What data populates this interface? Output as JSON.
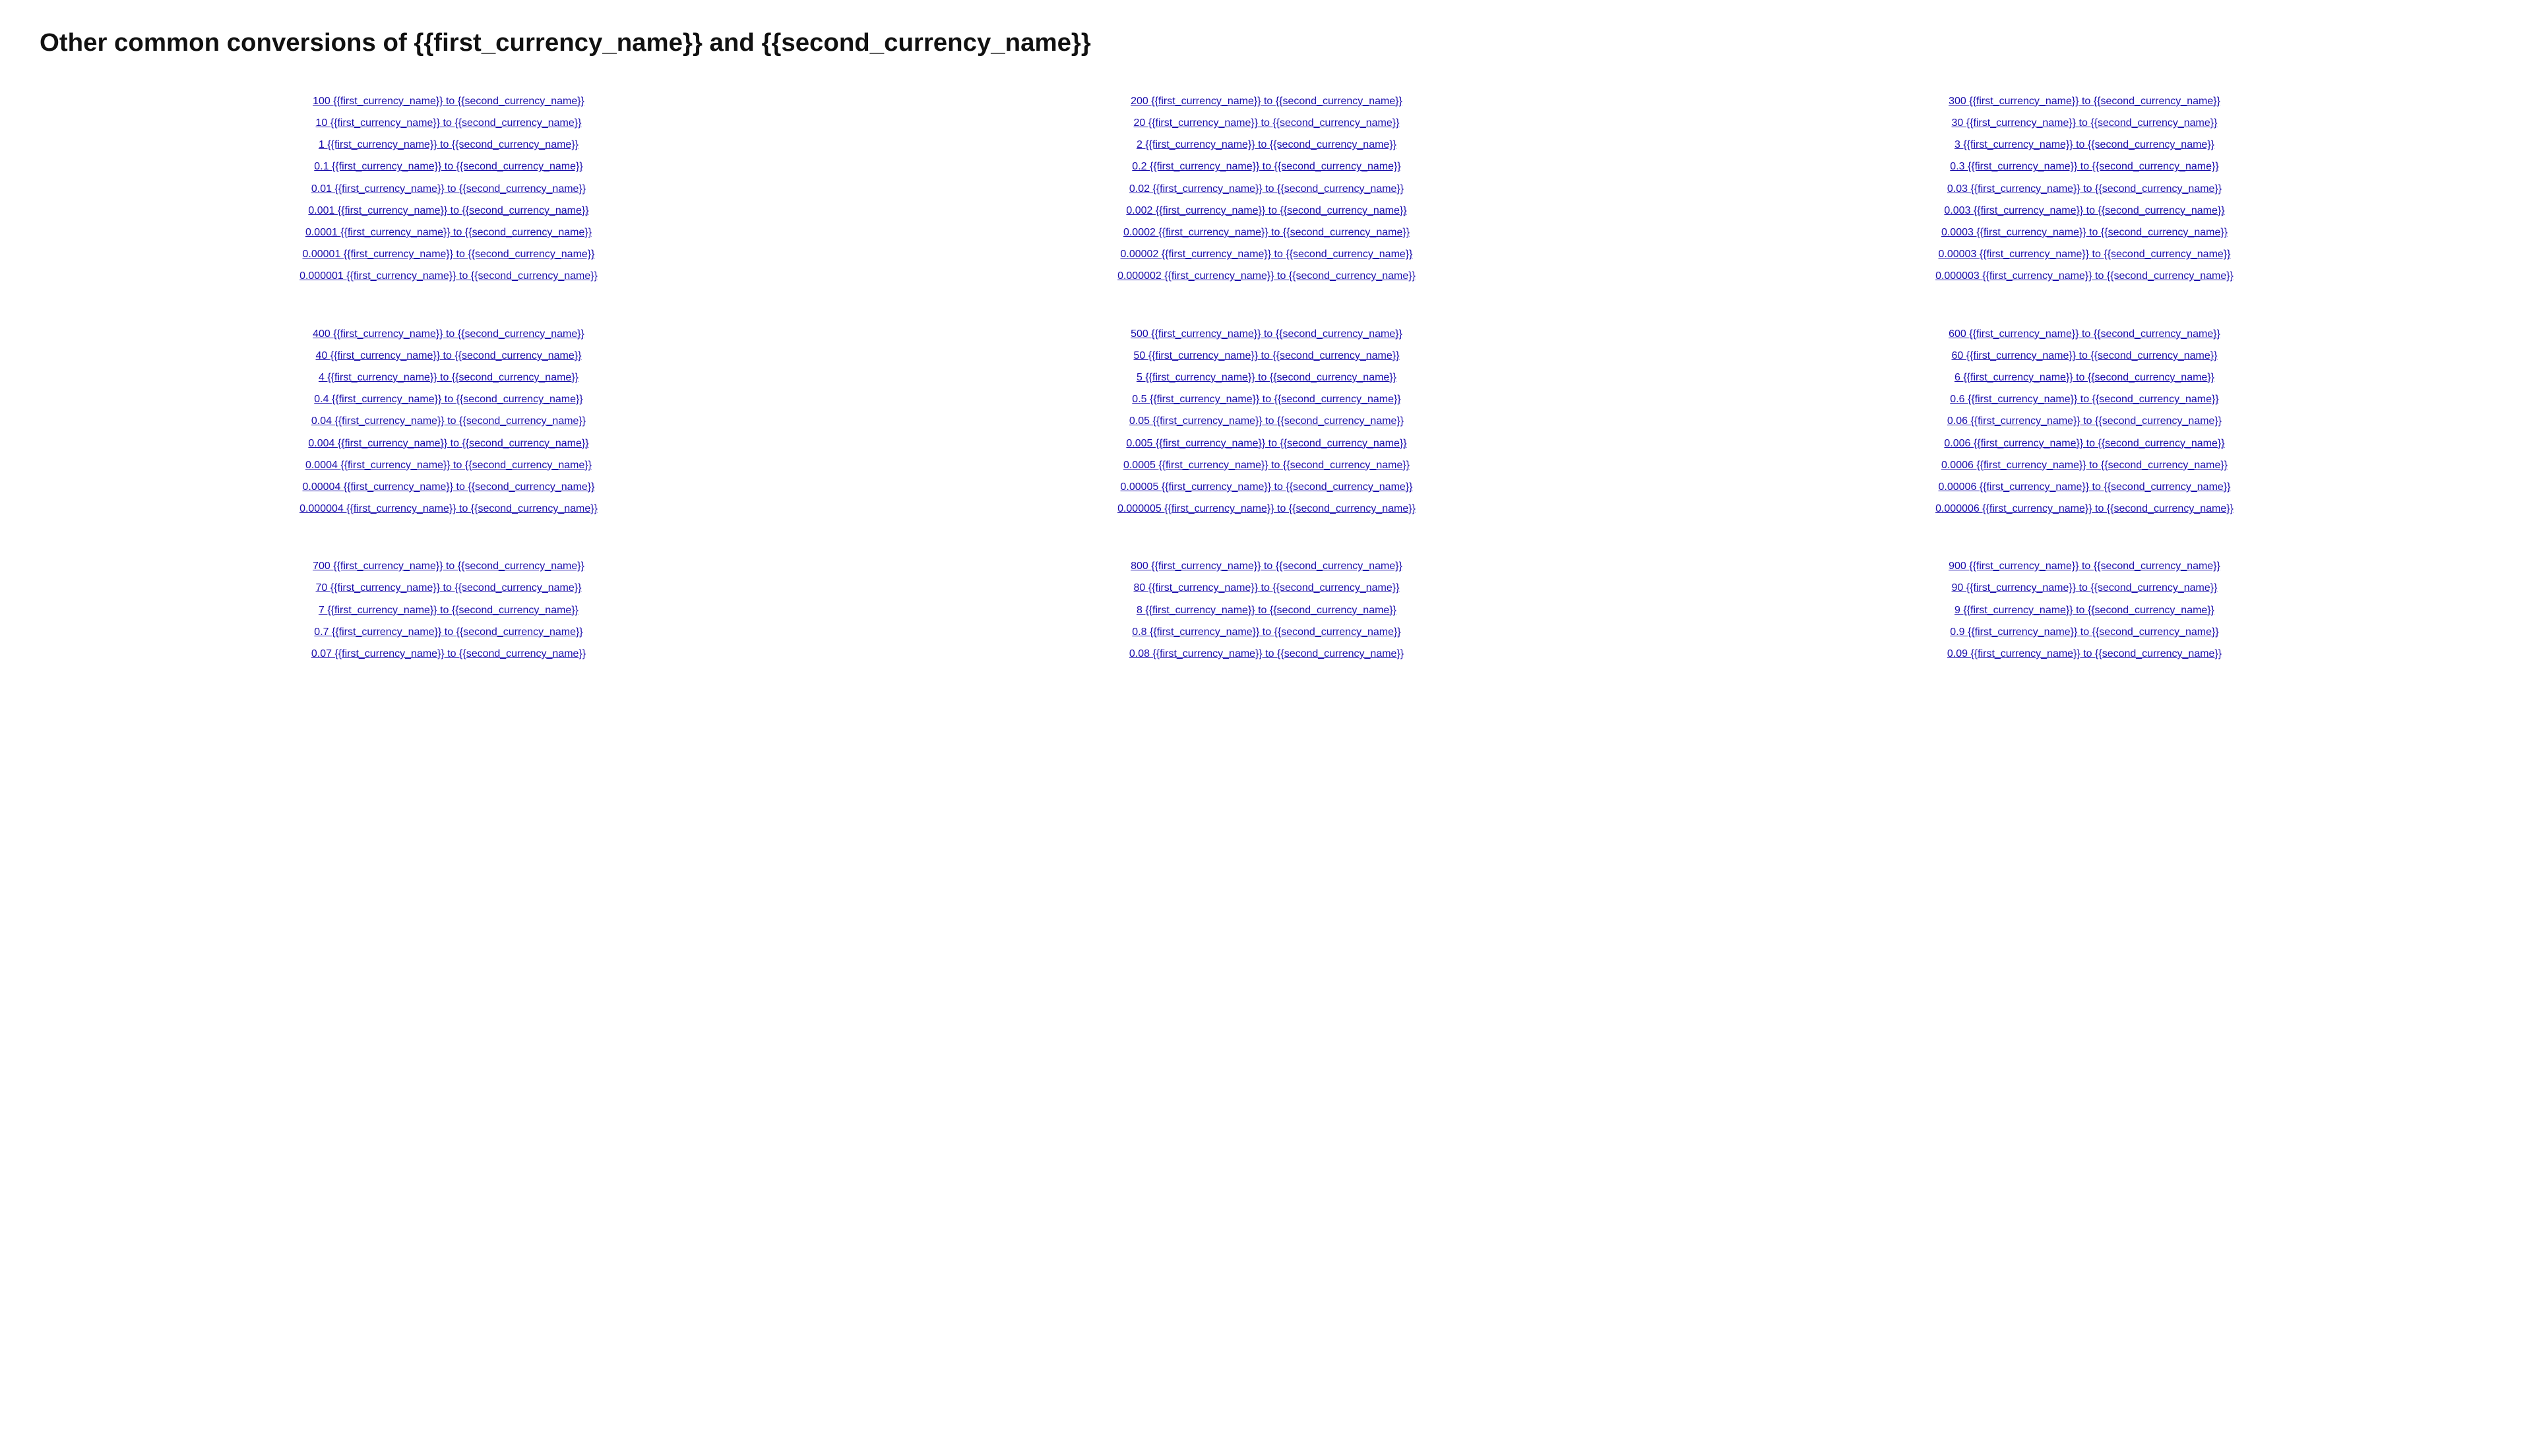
{
  "header": {
    "title": "Other common conversions of {{first_currency_name}} and {{second_currency_name}}"
  },
  "sections": [
    {
      "id": "section-1-3",
      "columns": [
        {
          "links": [
            "100 {{first_currency_name}} to {{second_currency_name}}",
            "10 {{first_currency_name}} to {{second_currency_name}}",
            "1 {{first_currency_name}} to {{second_currency_name}}",
            "0.1 {{first_currency_name}} to {{second_currency_name}}",
            "0.01 {{first_currency_name}} to {{second_currency_name}}",
            "0.001 {{first_currency_name}} to {{second_currency_name}}",
            "0.0001 {{first_currency_name}} to {{second_currency_name}}",
            "0.00001 {{first_currency_name}} to {{second_currency_name}}",
            "0.000001 {{first_currency_name}} to {{second_currency_name}}"
          ]
        },
        {
          "links": [
            "200 {{first_currency_name}} to {{second_currency_name}}",
            "20 {{first_currency_name}} to {{second_currency_name}}",
            "2 {{first_currency_name}} to {{second_currency_name}}",
            "0.2 {{first_currency_name}} to {{second_currency_name}}",
            "0.02 {{first_currency_name}} to {{second_currency_name}}",
            "0.002 {{first_currency_name}} to {{second_currency_name}}",
            "0.0002 {{first_currency_name}} to {{second_currency_name}}",
            "0.00002 {{first_currency_name}} to {{second_currency_name}}",
            "0.000002 {{first_currency_name}} to {{second_currency_name}}"
          ]
        },
        {
          "links": [
            "300 {{first_currency_name}} to {{second_currency_name}}",
            "30 {{first_currency_name}} to {{second_currency_name}}",
            "3 {{first_currency_name}} to {{second_currency_name}}",
            "0.3 {{first_currency_name}} to {{second_currency_name}}",
            "0.03 {{first_currency_name}} to {{second_currency_name}}",
            "0.003 {{first_currency_name}} to {{second_currency_name}}",
            "0.0003 {{first_currency_name}} to {{second_currency_name}}",
            "0.00003 {{first_currency_name}} to {{second_currency_name}}",
            "0.000003 {{first_currency_name}} to {{second_currency_name}}"
          ]
        }
      ]
    },
    {
      "id": "section-4-6",
      "columns": [
        {
          "links": [
            "400 {{first_currency_name}} to {{second_currency_name}}",
            "40 {{first_currency_name}} to {{second_currency_name}}",
            "4 {{first_currency_name}} to {{second_currency_name}}",
            "0.4 {{first_currency_name}} to {{second_currency_name}}",
            "0.04 {{first_currency_name}} to {{second_currency_name}}",
            "0.004 {{first_currency_name}} to {{second_currency_name}}",
            "0.0004 {{first_currency_name}} to {{second_currency_name}}",
            "0.00004 {{first_currency_name}} to {{second_currency_name}}",
            "0.000004 {{first_currency_name}} to {{second_currency_name}}"
          ]
        },
        {
          "links": [
            "500 {{first_currency_name}} to {{second_currency_name}}",
            "50 {{first_currency_name}} to {{second_currency_name}}",
            "5 {{first_currency_name}} to {{second_currency_name}}",
            "0.5 {{first_currency_name}} to {{second_currency_name}}",
            "0.05 {{first_currency_name}} to {{second_currency_name}}",
            "0.005 {{first_currency_name}} to {{second_currency_name}}",
            "0.0005 {{first_currency_name}} to {{second_currency_name}}",
            "0.00005 {{first_currency_name}} to {{second_currency_name}}",
            "0.000005 {{first_currency_name}} to {{second_currency_name}}"
          ]
        },
        {
          "links": [
            "600 {{first_currency_name}} to {{second_currency_name}}",
            "60 {{first_currency_name}} to {{second_currency_name}}",
            "6 {{first_currency_name}} to {{second_currency_name}}",
            "0.6 {{first_currency_name}} to {{second_currency_name}}",
            "0.06 {{first_currency_name}} to {{second_currency_name}}",
            "0.006 {{first_currency_name}} to {{second_currency_name}}",
            "0.0006 {{first_currency_name}} to {{second_currency_name}}",
            "0.00006 {{first_currency_name}} to {{second_currency_name}}",
            "0.000006 {{first_currency_name}} to {{second_currency_name}}"
          ]
        }
      ]
    },
    {
      "id": "section-7-9",
      "columns": [
        {
          "links": [
            "700 {{first_currency_name}} to {{second_currency_name}}",
            "70 {{first_currency_name}} to {{second_currency_name}}",
            "7 {{first_currency_name}} to {{second_currency_name}}",
            "0.7 {{first_currency_name}} to {{second_currency_name}}",
            "0.07 {{first_currency_name}} to {{second_currency_name}}"
          ]
        },
        {
          "links": [
            "800 {{first_currency_name}} to {{second_currency_name}}",
            "80 {{first_currency_name}} to {{second_currency_name}}",
            "8 {{first_currency_name}} to {{second_currency_name}}",
            "0.8 {{first_currency_name}} to {{second_currency_name}}",
            "0.08 {{first_currency_name}} to {{second_currency_name}}"
          ]
        },
        {
          "links": [
            "900 {{first_currency_name}} to {{second_currency_name}}",
            "90 {{first_currency_name}} to {{second_currency_name}}",
            "9 {{first_currency_name}} to {{second_currency_name}}",
            "0.9 {{first_currency_name}} to {{second_currency_name}}",
            "0.09 {{first_currency_name}} to {{second_currency_name}}"
          ]
        }
      ]
    }
  ]
}
